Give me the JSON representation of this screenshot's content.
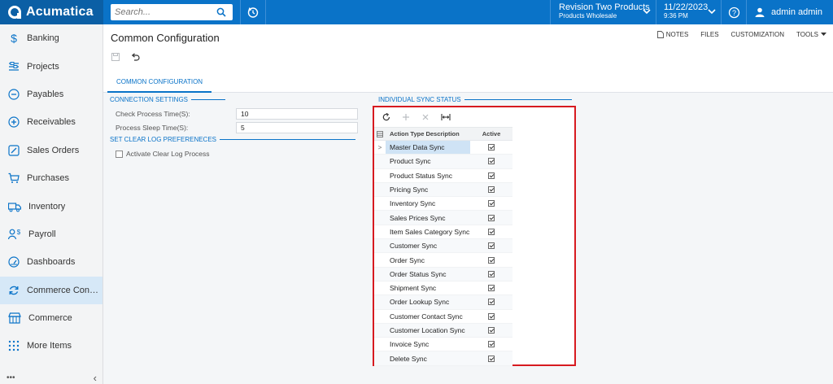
{
  "app": {
    "brand": "Acumatica",
    "search_placeholder": "Search...",
    "tenant_name": "Revision Two Products",
    "tenant_branch": "Products Wholesale",
    "date": "11/22/2023",
    "time": "9:36 PM",
    "user": "admin admin"
  },
  "sidebar": {
    "items": [
      {
        "label": "Banking",
        "icon": "dollar-icon"
      },
      {
        "label": "Projects",
        "icon": "projects-icon"
      },
      {
        "label": "Payables",
        "icon": "minus-circle-icon"
      },
      {
        "label": "Receivables",
        "icon": "plus-circle-icon"
      },
      {
        "label": "Sales Orders",
        "icon": "edit-icon"
      },
      {
        "label": "Purchases",
        "icon": "cart-icon"
      },
      {
        "label": "Inventory",
        "icon": "truck-icon"
      },
      {
        "label": "Payroll",
        "icon": "payroll-icon"
      },
      {
        "label": "Dashboards",
        "icon": "gauge-icon"
      },
      {
        "label": "Commerce Connec…",
        "icon": "sync-icon"
      },
      {
        "label": "Commerce",
        "icon": "store-icon"
      },
      {
        "label": "More Items",
        "icon": "grid-icon"
      }
    ],
    "footer_dots": "•••",
    "footer_collapse": "‹"
  },
  "page": {
    "title": "Common Configuration",
    "links": {
      "notes": "NOTES",
      "files": "FILES",
      "customization": "CUSTOMIZATION",
      "tools": "TOOLS"
    },
    "tab": "COMMON CONFIGURATION"
  },
  "form": {
    "connection_settings": "CONNECTION SETTINGS",
    "check_label": "Check Process Time(S):",
    "check_value": "10",
    "sleep_label": "Process Sleep Time(S):",
    "sleep_value": "5",
    "clear_log": "SET CLEAR LOG PREFERENECES",
    "activate_label": "Activate Clear Log Process"
  },
  "grid": {
    "section": "INDIVIDUAL SYNC STATUS",
    "col_desc": "Action Type Description",
    "col_active": "Active",
    "rows": [
      "Master Data Sync",
      "Product Sync",
      "Product Status Sync",
      "Pricing Sync",
      "Inventory Sync",
      "Sales Prices Sync",
      "Item Sales Category Sync",
      "Customer Sync",
      "Order Sync",
      "Order Status Sync",
      "Shipment Sync",
      "Order Lookup Sync",
      "Customer Contact Sync",
      "Customer Location Sync",
      "Invoice Sync",
      "Delete Sync"
    ]
  }
}
